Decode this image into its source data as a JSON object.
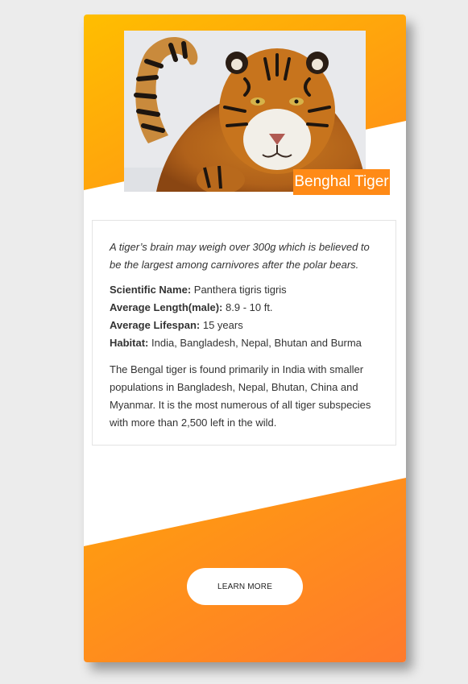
{
  "card": {
    "title": "Benghal Tiger",
    "image_alt": "Bengal tiger walking in snow",
    "fact": "A tiger’s brain may weigh over 300g which is believed to be the largest among carnivores after the polar bears.",
    "attributes": [
      {
        "label": "Scientific Name:",
        "value": "Panthera tigris tigris"
      },
      {
        "label": "Average Length(male):",
        "value": "8.9 - 10 ft."
      },
      {
        "label": "Average Lifespan:",
        "value": "15 years"
      },
      {
        "label": "Habitat:",
        "value": "India, Bangladesh, Nepal, Bhutan and Burma"
      }
    ],
    "description": "The Bengal tiger is found primarily in India with smaller populations in Bangladesh, Nepal, Bhutan, China and Myanmar. It is the most numerous of all tiger subspecies with more than 2,500 left in the wild.",
    "button_label": "LEARN MORE"
  },
  "colors": {
    "gradient_start": "#ffbe00",
    "gradient_end": "#ff7a2c",
    "badge": "#ff8a16",
    "page_background": "#ececec"
  }
}
